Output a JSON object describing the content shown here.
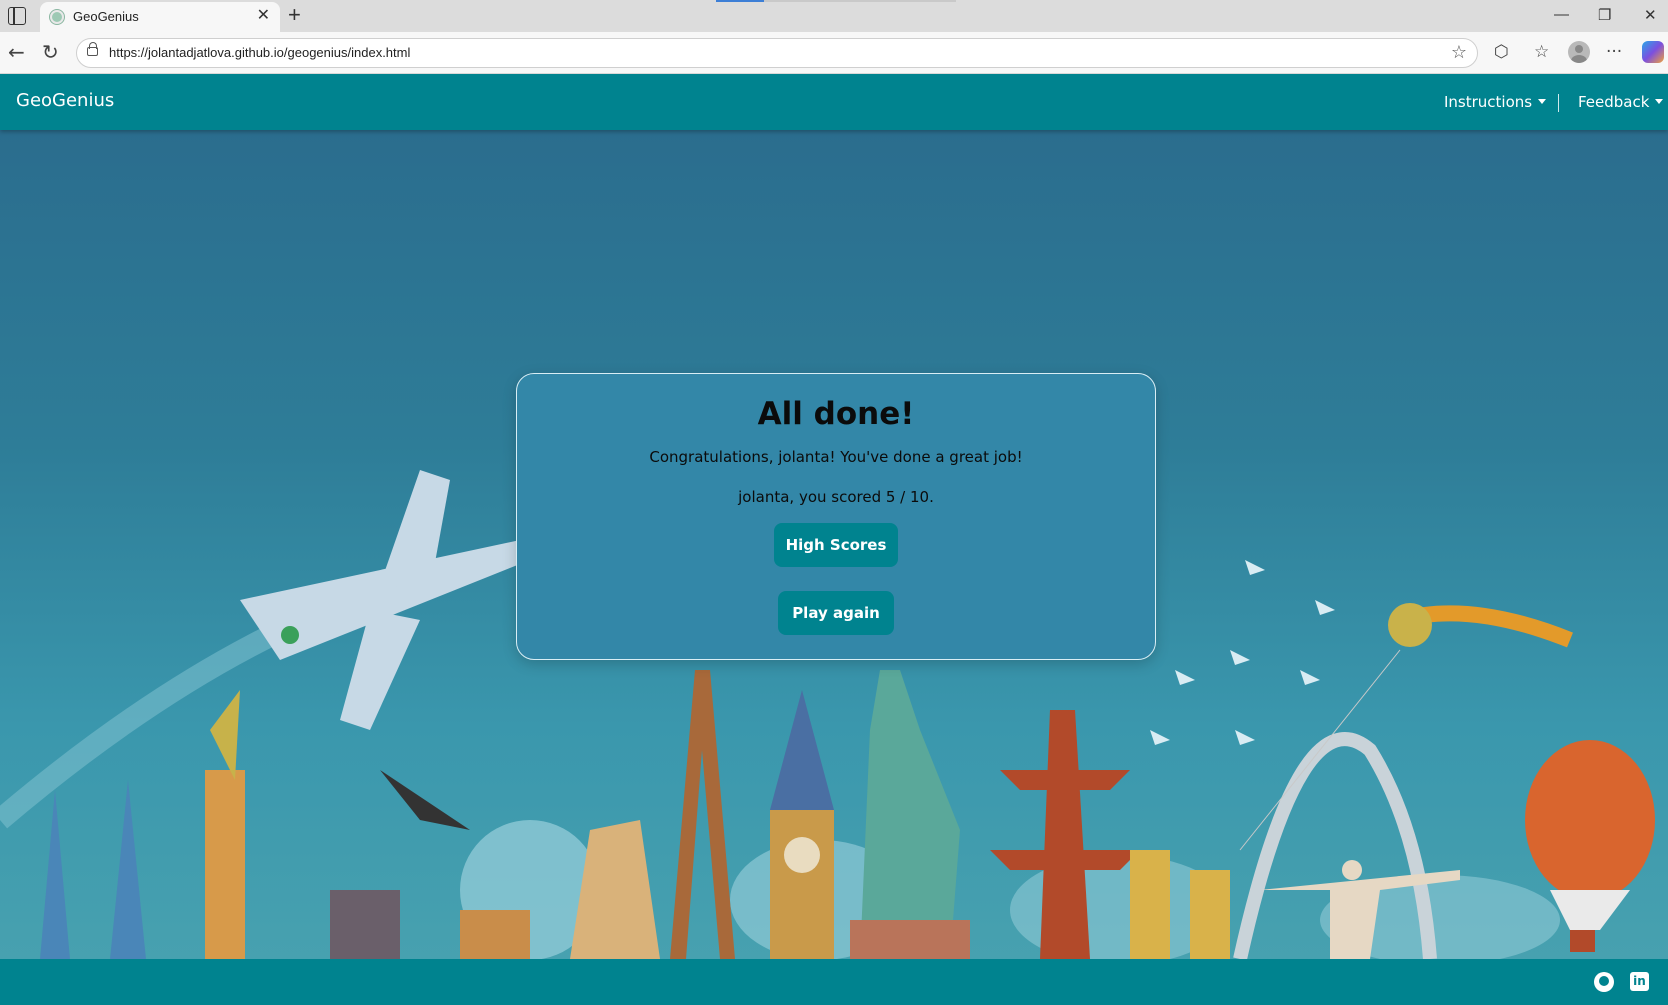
{
  "browser": {
    "tab_title": "GeoGenius",
    "tab_close": "✕",
    "new_tab": "+",
    "url": "https://jolantadjatlova.github.io/geogenius/index.html",
    "window_controls": {
      "minimize": "—",
      "restore": "❐",
      "close": "✕"
    },
    "nav": {
      "back": "←",
      "reload": "↻"
    },
    "toolbar": {
      "star": "☆",
      "extensions": "⬡",
      "favorites": "☆",
      "more": "···"
    }
  },
  "navbar": {
    "brand": "GeoGenius",
    "links": [
      {
        "label": "Instructions"
      },
      {
        "label": "Feedback"
      }
    ]
  },
  "modal": {
    "title": "All done!",
    "message": "Congratulations, jolanta! You've done a great job!",
    "score_text": "jolanta, you scored 5 / 10.",
    "buttons": {
      "high_scores": "High Scores",
      "play_again": "Play again"
    }
  },
  "footer": {
    "icons": [
      "github-icon",
      "linkedin-icon"
    ],
    "linkedin_glyph": "in"
  },
  "colors": {
    "primary": "#00838f",
    "modal_bg": "#3387a8",
    "sky_top": "#2a6a8c",
    "sky_bottom": "#4aa3b0"
  }
}
